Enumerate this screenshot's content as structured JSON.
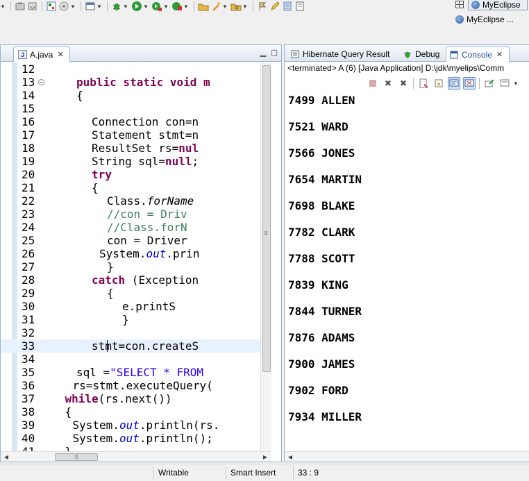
{
  "perspectives": {
    "active": "MyEclipse",
    "other": "MyEclipse ..."
  },
  "editor": {
    "tab_label": "A.java",
    "scroll_thumb_marker": "≡",
    "lines": [
      {
        "n": "12",
        "indent": 0,
        "parts": []
      },
      {
        "n": "13",
        "indent": 4,
        "fold": true,
        "parts": [
          {
            "t": "public static void m",
            "c": "kw"
          }
        ]
      },
      {
        "n": "14",
        "indent": 4,
        "parts": [
          {
            "t": "{",
            "c": ""
          }
        ]
      },
      {
        "n": "15",
        "indent": 0,
        "parts": []
      },
      {
        "n": "16",
        "indent": 6,
        "parts": [
          {
            "t": "Connection con=n",
            "c": ""
          }
        ]
      },
      {
        "n": "17",
        "indent": 6,
        "parts": [
          {
            "t": "Statement stmt=n",
            "c": ""
          }
        ]
      },
      {
        "n": "18",
        "indent": 6,
        "parts": [
          {
            "t": "ResultSet rs=",
            "c": ""
          },
          {
            "t": "nul",
            "c": "kw"
          }
        ]
      },
      {
        "n": "19",
        "indent": 6,
        "parts": [
          {
            "t": "String sql=",
            "c": ""
          },
          {
            "t": "null",
            "c": "kw"
          },
          {
            "t": ";",
            "c": ""
          }
        ]
      },
      {
        "n": "20",
        "indent": 6,
        "parts": [
          {
            "t": "try",
            "c": "kw"
          }
        ]
      },
      {
        "n": "21",
        "indent": 6,
        "parts": [
          {
            "t": "{",
            "c": ""
          }
        ]
      },
      {
        "n": "22",
        "indent": 8,
        "parts": [
          {
            "t": "Class.",
            "c": ""
          },
          {
            "t": "forName",
            "c": "ital"
          }
        ]
      },
      {
        "n": "23",
        "indent": 8,
        "parts": [
          {
            "t": "//con = Driv",
            "c": "cmt"
          }
        ]
      },
      {
        "n": "24",
        "indent": 8,
        "parts": [
          {
            "t": "//Class.forN",
            "c": "cmt"
          }
        ]
      },
      {
        "n": "25",
        "indent": 8,
        "parts": [
          {
            "t": "con = Driver",
            "c": ""
          }
        ]
      },
      {
        "n": "26",
        "indent": 7,
        "parts": [
          {
            "t": "System.",
            "c": ""
          },
          {
            "t": "out",
            "c": "fld"
          },
          {
            "t": ".prin",
            "c": ""
          }
        ]
      },
      {
        "n": "27",
        "indent": 8,
        "parts": [
          {
            "t": "}",
            "c": ""
          }
        ]
      },
      {
        "n": "28",
        "indent": 6,
        "parts": [
          {
            "t": "catch",
            "c": "kw"
          },
          {
            "t": " (Exception",
            "c": ""
          }
        ]
      },
      {
        "n": "29",
        "indent": 8,
        "parts": [
          {
            "t": "{",
            "c": ""
          }
        ]
      },
      {
        "n": "30",
        "indent": 10,
        "parts": [
          {
            "t": "e.printS",
            "c": ""
          }
        ]
      },
      {
        "n": "31",
        "indent": 10,
        "parts": [
          {
            "t": "}",
            "c": ""
          }
        ]
      },
      {
        "n": "32",
        "indent": 0,
        "parts": []
      },
      {
        "n": "33",
        "indent": 6,
        "current": true,
        "parts": [
          {
            "t": "stmt=con.createS",
            "c": ""
          }
        ]
      },
      {
        "n": "34",
        "indent": 0,
        "parts": []
      },
      {
        "n": "35",
        "indent": 4,
        "parts": [
          {
            "t": "sql =",
            "c": ""
          },
          {
            "t": "\"SELECT * FROM",
            "c": "str"
          }
        ]
      },
      {
        "n": "36",
        "indent": 3.5,
        "parts": [
          {
            "t": "rs=stmt.executeQuery(",
            "c": ""
          }
        ]
      },
      {
        "n": "37",
        "indent": 2.5,
        "parts": [
          {
            "t": "while",
            "c": "kw"
          },
          {
            "t": "(rs.next())",
            "c": ""
          }
        ]
      },
      {
        "n": "38",
        "indent": 2.5,
        "parts": [
          {
            "t": "{",
            "c": ""
          }
        ]
      },
      {
        "n": "39",
        "indent": 3.5,
        "parts": [
          {
            "t": "System.",
            "c": ""
          },
          {
            "t": "out",
            "c": "fld"
          },
          {
            "t": ".println(rs.",
            "c": ""
          }
        ]
      },
      {
        "n": "40",
        "indent": 3.5,
        "parts": [
          {
            "t": "System.",
            "c": ""
          },
          {
            "t": "out",
            "c": "fld"
          },
          {
            "t": ".println();",
            "c": ""
          }
        ]
      },
      {
        "n": "41",
        "indent": 2.5,
        "parts": [
          {
            "t": "}",
            "c": ""
          }
        ]
      }
    ]
  },
  "console_view": {
    "tabs": [
      {
        "label": "Hibernate Query Result",
        "icon": "hibernate-icon"
      },
      {
        "label": "Debug",
        "icon": "debug-icon"
      },
      {
        "label": "Console",
        "icon": "console-icon",
        "active": true
      }
    ],
    "description": "<terminated> A (6) [Java Application] D:\\jdk\\myelips\\Comm",
    "output": [
      "7499 ALLEN",
      "7521 WARD",
      "7566 JONES",
      "7654 MARTIN",
      "7698 BLAKE",
      "7782 CLARK",
      "7788 SCOTT",
      "7839 KING",
      "7844 TURNER",
      "7876 ADAMS",
      "7900 JAMES",
      "7902 FORD",
      "7934 MILLER"
    ]
  },
  "status": {
    "writable": "Writable",
    "insert_mode": "Smart Insert",
    "position": "33 : 9"
  },
  "colors": {
    "keyword": "#7f0055",
    "string": "#2a00ff",
    "comment": "#3f7f5f",
    "field": "#0000c0",
    "current_line": "#e8f2fe",
    "view_border": "#99b4d1"
  }
}
